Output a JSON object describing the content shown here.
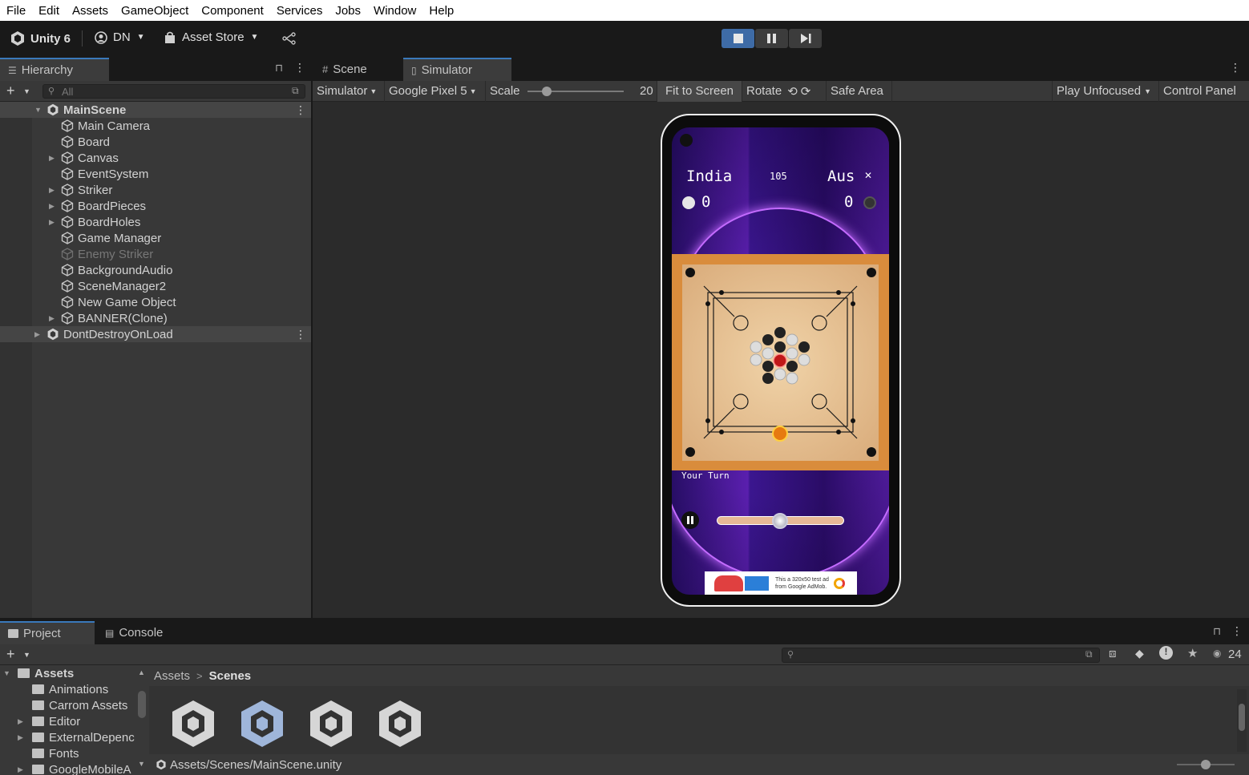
{
  "menu": [
    "File",
    "Edit",
    "Assets",
    "GameObject",
    "Component",
    "Services",
    "Jobs",
    "Window",
    "Help"
  ],
  "toolbar": {
    "unity_label": "Unity 6",
    "account": "DN",
    "asset_store": "Asset Store"
  },
  "tabs": {
    "hierarchy": "Hierarchy",
    "scene": "Scene",
    "simulator": "Simulator",
    "project": "Project",
    "console": "Console"
  },
  "hierarchy": {
    "search_placeholder": "All",
    "scene": "MainScene",
    "items": [
      {
        "label": "Main Camera",
        "expandable": false,
        "disabled": false
      },
      {
        "label": "Board",
        "expandable": false,
        "disabled": false
      },
      {
        "label": "Canvas",
        "expandable": true,
        "disabled": false
      },
      {
        "label": "EventSystem",
        "expandable": false,
        "disabled": false
      },
      {
        "label": "Striker",
        "expandable": true,
        "disabled": false
      },
      {
        "label": "BoardPieces",
        "expandable": true,
        "disabled": false
      },
      {
        "label": "BoardHoles",
        "expandable": true,
        "disabled": false
      },
      {
        "label": "Game Manager",
        "expandable": false,
        "disabled": false
      },
      {
        "label": "Enemy Striker",
        "expandable": false,
        "disabled": true
      },
      {
        "label": "BackgroundAudio",
        "expandable": false,
        "disabled": false
      },
      {
        "label": "SceneManager2",
        "expandable": false,
        "disabled": false
      },
      {
        "label": "New Game Object",
        "expandable": false,
        "disabled": false
      },
      {
        "label": "BANNER(Clone)",
        "expandable": true,
        "disabled": false
      }
    ],
    "dontdestroy": "DontDestroyOnLoad"
  },
  "simbar": {
    "simulator": "Simulator",
    "device": "Google Pixel 5",
    "scale_label": "Scale",
    "scale_value": "20",
    "scale_level": 0.1,
    "fit": "Fit to Screen",
    "rotate": "Rotate",
    "safe_area": "Safe Area",
    "play_mode": "Play Unfocused",
    "control_panel": "Control Panel"
  },
  "game": {
    "player1": "India",
    "player2": "Aus",
    "timer": "105",
    "score1": "0",
    "score2": "0",
    "turn": "Your Turn",
    "ad_line1": "This a 320x50 test ad",
    "ad_line2": "from Google AdMob."
  },
  "project": {
    "tree": [
      {
        "label": "Assets",
        "expandable": true,
        "bold": true
      },
      {
        "label": "Animations",
        "expandable": false,
        "bold": false
      },
      {
        "label": "Carrom Assets",
        "expandable": false,
        "bold": false
      },
      {
        "label": "Editor",
        "expandable": true,
        "bold": false
      },
      {
        "label": "ExternalDepenc",
        "expandable": true,
        "bold": false
      },
      {
        "label": "Fonts",
        "expandable": false,
        "bold": false
      },
      {
        "label": "GoogleMobileA",
        "expandable": true,
        "bold": false
      }
    ],
    "breadcrumb_root": "Assets",
    "breadcrumb_current": "Scenes",
    "status_path": "Assets/Scenes/MainScene.unity",
    "hidden_count": "24"
  },
  "colors": {
    "accent": "#3e6ba6",
    "panel": "#383838",
    "dark": "#191919"
  }
}
